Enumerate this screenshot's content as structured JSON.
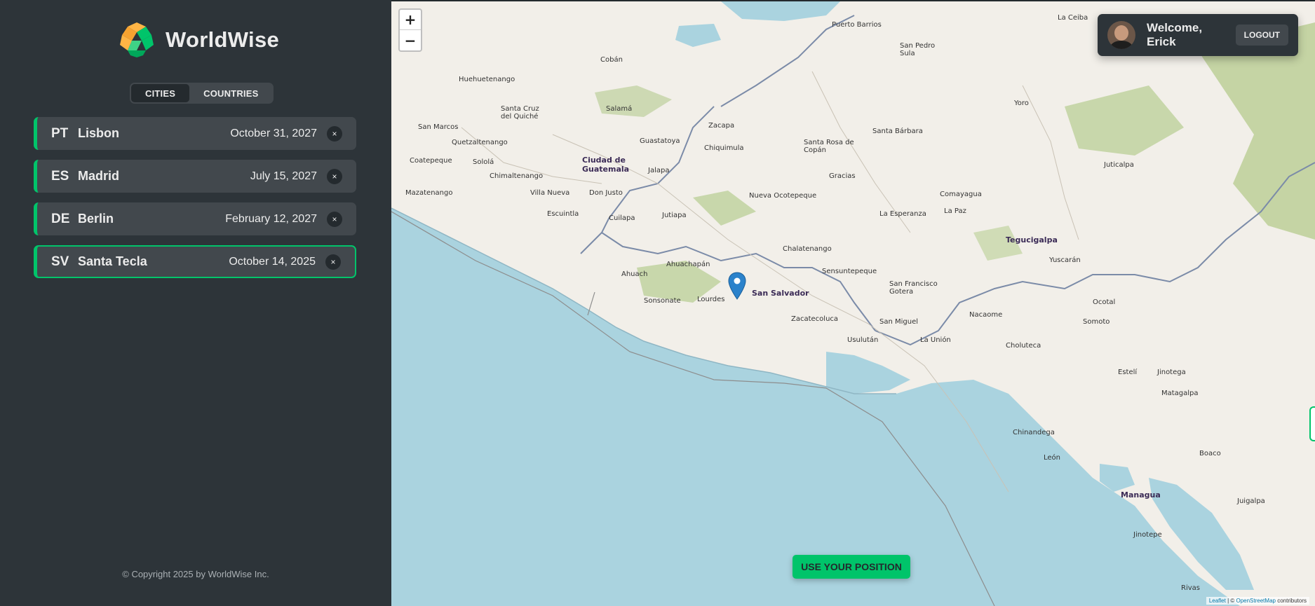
{
  "app": {
    "brand": "WorldWise",
    "copyright": "© Copyright 2025 by WorldWise Inc."
  },
  "tabs": [
    {
      "label": "CITIES",
      "active": true
    },
    {
      "label": "COUNTRIES",
      "active": false
    }
  ],
  "cities": [
    {
      "code": "PT",
      "name": "Lisbon",
      "date": "October 31, 2027",
      "delete": "×"
    },
    {
      "code": "ES",
      "name": "Madrid",
      "date": "July 15, 2027",
      "delete": "×"
    },
    {
      "code": "DE",
      "name": "Berlin",
      "date": "February 12, 2027",
      "delete": "×"
    },
    {
      "code": "SV",
      "name": "Santa Tecla",
      "date": "October 14, 2025",
      "delete": "×",
      "active": true
    }
  ],
  "user": {
    "welcome": "Welcome, Erick",
    "logout_label": "LOGOUT"
  },
  "map": {
    "zoom_in": "+",
    "zoom_out": "−",
    "use_position_label": "USE YOUR POSITION",
    "attribution_leaflet": "Leaflet",
    "attribution_sep": " | © ",
    "attribution_osm": "OpenStreetMap",
    "attribution_tail": " contributors",
    "labels": [
      {
        "text": "Puerto Barrios",
        "kind": "town"
      },
      {
        "text": "La Ceiba",
        "kind": "town"
      },
      {
        "text": "Cobán",
        "kind": "town"
      },
      {
        "text": "Huehuetenango",
        "kind": "town"
      },
      {
        "text": "San Pedro Sula",
        "kind": "town"
      },
      {
        "text": "Salamá",
        "kind": "town"
      },
      {
        "text": "Santa Cruz del Quiché",
        "kind": "town"
      },
      {
        "text": "San Marcos",
        "kind": "town"
      },
      {
        "text": "Quetzaltenango",
        "kind": "town"
      },
      {
        "text": "Coatepeque",
        "kind": "town"
      },
      {
        "text": "Sololá",
        "kind": "town"
      },
      {
        "text": "Chimaltenango",
        "kind": "town"
      },
      {
        "text": "Mazatenango",
        "kind": "town"
      },
      {
        "text": "Ciudad de Guatemala",
        "kind": "capital"
      },
      {
        "text": "Guastatoya",
        "kind": "town"
      },
      {
        "text": "Zacapa",
        "kind": "town"
      },
      {
        "text": "Chiquimula",
        "kind": "town"
      },
      {
        "text": "Jalapa",
        "kind": "town"
      },
      {
        "text": "Villa Nueva",
        "kind": "town"
      },
      {
        "text": "Don Justo",
        "kind": "town"
      },
      {
        "text": "Escuintla",
        "kind": "town"
      },
      {
        "text": "Cuilapa",
        "kind": "town"
      },
      {
        "text": "Jutiapa",
        "kind": "town"
      },
      {
        "text": "Santa Rosa de Copán",
        "kind": "town"
      },
      {
        "text": "Santa Bárbara",
        "kind": "town"
      },
      {
        "text": "Gracias",
        "kind": "town"
      },
      {
        "text": "Nueva Ocotepeque",
        "kind": "town"
      },
      {
        "text": "Yoro",
        "kind": "town"
      },
      {
        "text": "Juticalpa",
        "kind": "town"
      },
      {
        "text": "Comayagua",
        "kind": "town"
      },
      {
        "text": "La Esperanza",
        "kind": "town"
      },
      {
        "text": "La Paz",
        "kind": "town"
      },
      {
        "text": "Tegucigalpa",
        "kind": "capital"
      },
      {
        "text": "Yuscarán",
        "kind": "town"
      },
      {
        "text": "Chalatenango",
        "kind": "town"
      },
      {
        "text": "Ahuachapán",
        "kind": "town"
      },
      {
        "text": "Ahuach",
        "kind": "town"
      },
      {
        "text": "Sensuntepeque",
        "kind": "town"
      },
      {
        "text": "San Francisco Gotera",
        "kind": "town"
      },
      {
        "text": "Sonsonate",
        "kind": "town"
      },
      {
        "text": "Lourdes",
        "kind": "town"
      },
      {
        "text": "San Salvador",
        "kind": "capital"
      },
      {
        "text": "Zacatecoluca",
        "kind": "town"
      },
      {
        "text": "San Miguel",
        "kind": "town"
      },
      {
        "text": "Nacaome",
        "kind": "town"
      },
      {
        "text": "Ocotal",
        "kind": "town"
      },
      {
        "text": "Somoto",
        "kind": "town"
      },
      {
        "text": "Usulután",
        "kind": "town"
      },
      {
        "text": "La Unión",
        "kind": "town"
      },
      {
        "text": "Choluteca",
        "kind": "town"
      },
      {
        "text": "Estelí",
        "kind": "town"
      },
      {
        "text": "Jinotega",
        "kind": "town"
      },
      {
        "text": "Matagalpa",
        "kind": "town"
      },
      {
        "text": "Chinandega",
        "kind": "town"
      },
      {
        "text": "León",
        "kind": "town"
      },
      {
        "text": "Boaco",
        "kind": "town"
      },
      {
        "text": "Managua",
        "kind": "capital"
      },
      {
        "text": "Juigalpa",
        "kind": "town"
      },
      {
        "text": "Jinotepe",
        "kind": "town"
      },
      {
        "text": "Rivas",
        "kind": "town"
      }
    ]
  },
  "colors": {
    "accent": "#00c46a",
    "sidebar_bg": "#2d3439",
    "item_bg": "#42484d",
    "dark": "#242a2e",
    "sea": "#aad3df",
    "land": "#f2efe9",
    "forest": "#c8d7ab",
    "border": "#6b7f9c"
  },
  "icons": {
    "logo": "worldwise-globe-icon",
    "delete": "close-icon",
    "marker": "map-pin-icon"
  }
}
